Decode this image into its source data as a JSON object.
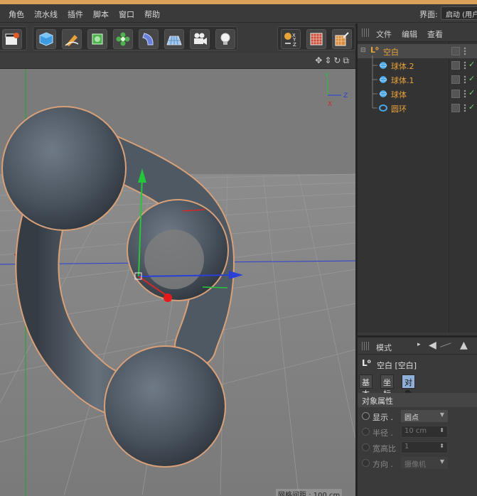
{
  "menu": {
    "items": [
      "角色",
      "流水线",
      "插件",
      "脚本",
      "窗口",
      "帮助"
    ],
    "layout_label": "界面:",
    "layout_value": "启动 (用户)"
  },
  "toolbar": {
    "icons": [
      "clapper-icon",
      "cube-icon",
      "pen-icon",
      "subdivide-icon",
      "array-icon",
      "deformer-icon",
      "floor-icon",
      "camera-icon",
      "light-icon",
      "axis-icon",
      "texture-icon",
      "paint-icon"
    ]
  },
  "viewport": {
    "grid_info": "网格间距 : 100 cm",
    "axis_y": "Y",
    "axis_z": "Z",
    "axis_x": "X"
  },
  "object_manager": {
    "menu": [
      "文件",
      "编辑",
      "查看"
    ],
    "objects": [
      {
        "name": "空白",
        "icon": "null-icon",
        "level": 0
      },
      {
        "name": "球体.2",
        "icon": "sphere-icon",
        "level": 1
      },
      {
        "name": "球体.1",
        "icon": "sphere-icon",
        "level": 1
      },
      {
        "name": "球体",
        "icon": "sphere-icon",
        "level": 1
      },
      {
        "name": "圆环",
        "icon": "torus-icon",
        "level": 1
      }
    ]
  },
  "attributes": {
    "mode_label": "模式",
    "object_title": "空白 [空白]",
    "tabs": [
      "基本",
      "坐标",
      "对象"
    ],
    "active_tab": "对象",
    "section": "对象属性",
    "fields": [
      {
        "label": "显示 .",
        "value": "圆点",
        "enabled": true
      },
      {
        "label": "半径 .",
        "value": "10 cm",
        "enabled": false
      },
      {
        "label": "宽高比",
        "value": "1",
        "enabled": false
      },
      {
        "label": "方向 .",
        "value": "摄像机",
        "enabled": false
      }
    ]
  },
  "colors": {
    "accent": "#e8a23a",
    "active_tab": "#8fb0d8",
    "check": "#6fd06f"
  }
}
